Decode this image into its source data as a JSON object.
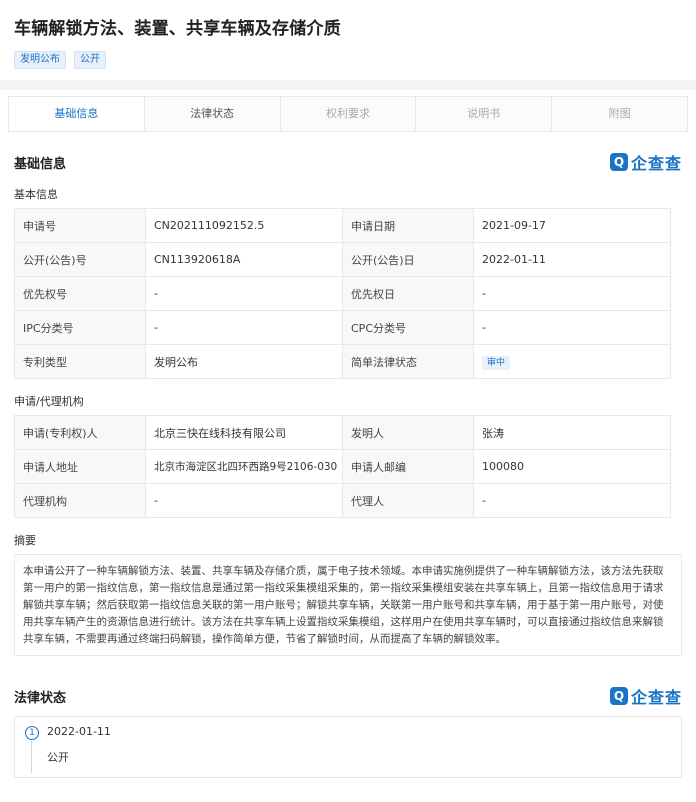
{
  "header": {
    "title": "车辆解锁方法、装置、共享车辆及存储介质",
    "tags": [
      "发明公布",
      "公开"
    ]
  },
  "tabs": [
    {
      "label": "基础信息",
      "state": "active"
    },
    {
      "label": "法律状态",
      "state": "normal"
    },
    {
      "label": "权利要求",
      "state": "dim"
    },
    {
      "label": "说明书",
      "state": "dim"
    },
    {
      "label": "附图",
      "state": "dim"
    }
  ],
  "brand": {
    "badge": "Q",
    "text": "企查查",
    "color": "#1a73c7"
  },
  "basic": {
    "section_title": "基础信息",
    "sub_title": "基本信息",
    "rows": [
      {
        "k1": "申请号",
        "v1": "CN202111092152.5",
        "k2": "申请日期",
        "v2": "2021-09-17"
      },
      {
        "k1": "公开(公告)号",
        "v1": "CN113920618A",
        "k2": "公开(公告)日",
        "v2": "2022-01-11"
      },
      {
        "k1": "优先权号",
        "v1": "-",
        "k2": "优先权日",
        "v2": "-"
      },
      {
        "k1": "IPC分类号",
        "v1": "-",
        "k2": "CPC分类号",
        "v2": "-"
      },
      {
        "k1": "专利类型",
        "v1": "发明公布",
        "k2": "简单法律状态",
        "v2": "审中"
      }
    ]
  },
  "agency": {
    "sub_title": "申请/代理机构",
    "rows": [
      {
        "k1": "申请(专利权)人",
        "v1": "北京三快在线科技有限公司",
        "k2": "发明人",
        "v2": "张涛"
      },
      {
        "k1": "申请人地址",
        "v1": "北京市海淀区北四环西路9号2106-030",
        "k2": "申请人邮编",
        "v2": "100080"
      },
      {
        "k1": "代理机构",
        "v1": "-",
        "k2": "代理人",
        "v2": "-"
      }
    ]
  },
  "abstract": {
    "title": "摘要",
    "text": "本申请公开了一种车辆解锁方法、装置、共享车辆及存储介质，属于电子技术领域。本申请实施例提供了一种车辆解锁方法，该方法先获取第一用户的第一指纹信息，第一指纹信息是通过第一指纹采集模组采集的，第一指纹采集模组安装在共享车辆上，且第一指纹信息用于请求解锁共享车辆；然后获取第一指纹信息关联的第一用户账号；解锁共享车辆，关联第一用户账号和共享车辆，用于基于第一用户账号，对使用共享车辆产生的资源信息进行统计。该方法在共享车辆上设置指纹采集模组，这样用户在使用共享车辆时，可以直接通过指纹信息来解锁共享车辆，不需要再通过终端扫码解锁，操作简单方便，节省了解锁时间，从而提高了车辆的解锁效率。"
  },
  "legal": {
    "section_title": "法律状态",
    "events": [
      {
        "index": "1",
        "date": "2022-01-11",
        "status": "公开"
      }
    ]
  }
}
